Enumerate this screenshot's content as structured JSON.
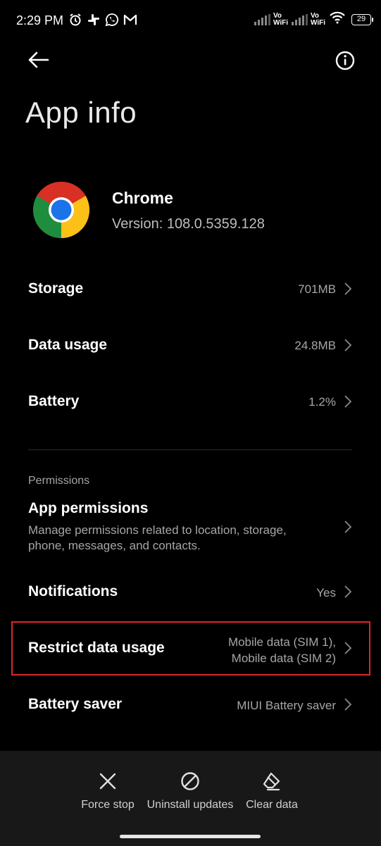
{
  "status_bar": {
    "time": "2:29 PM",
    "left_icons": [
      "alarm-icon",
      "slack-icon",
      "whatsapp-icon",
      "gmail-icon"
    ],
    "vowifi_1": "Vo WiFi",
    "vowifi_2": "Vo WiFi",
    "battery": "29"
  },
  "header": {
    "back_icon": "back-arrow-icon",
    "info_icon": "info-icon",
    "title": "App info"
  },
  "app": {
    "name": "Chrome",
    "version": "Version: 108.0.5359.128",
    "icon": "chrome-logo"
  },
  "rows": {
    "storage": {
      "label": "Storage",
      "value": "701MB"
    },
    "data_usage": {
      "label": "Data usage",
      "value": "24.8MB"
    },
    "battery": {
      "label": "Battery",
      "value": "1.2%"
    },
    "notifications": {
      "label": "Notifications",
      "value": "Yes"
    },
    "restrict": {
      "label": "Restrict data usage",
      "value_line1": "Mobile data (SIM 1),",
      "value_line2": "Mobile data (SIM 2)"
    },
    "battery_saver": {
      "label": "Battery saver",
      "value": "MIUI Battery saver"
    }
  },
  "permissions": {
    "section": "Permissions",
    "title": "App permissions",
    "description": "Manage permissions related to location, storage, phone, messages, and contacts."
  },
  "bottom_actions": {
    "force_stop": "Force stop",
    "uninstall_updates": "Uninstall updates",
    "clear_data": "Clear data"
  },
  "colors": {
    "background": "#000000",
    "bottom_bar": "#181818",
    "highlight": "#e0242b",
    "secondary_text": "#a6a6a6"
  }
}
